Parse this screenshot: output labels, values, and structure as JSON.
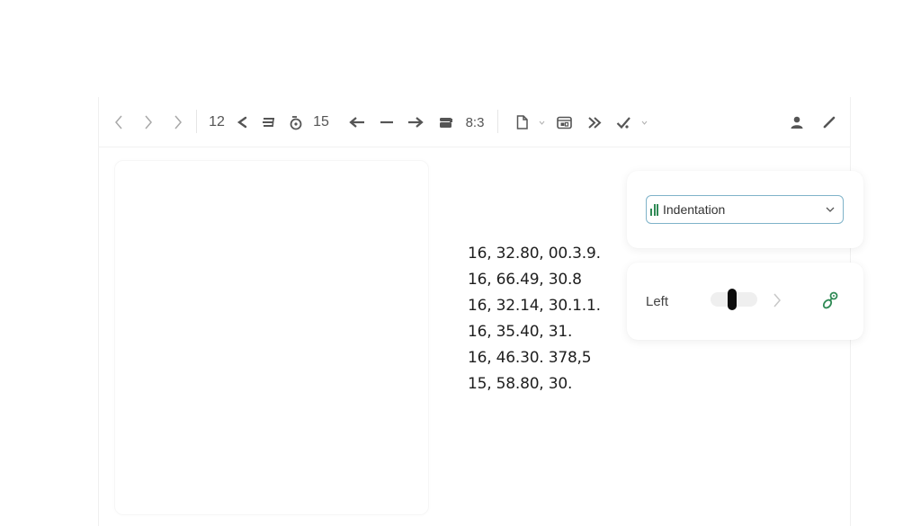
{
  "toolbar": {
    "items": [
      {
        "name": "back-icon",
        "glyph": "chevron-left"
      },
      {
        "name": "forward-icon",
        "glyph": "chevron-right"
      },
      {
        "name": "next-icon",
        "glyph": "chevron-right"
      },
      {
        "name": "font-size-value",
        "text": "12"
      },
      {
        "name": "decrease-indent-icon",
        "glyph": "angle-left-bold"
      },
      {
        "name": "list-style-icon",
        "glyph": "stacked-lines"
      },
      {
        "name": "timer-icon",
        "glyph": "stopwatch"
      },
      {
        "name": "spacing-value",
        "text": "15"
      },
      {
        "name": "arrow-left-icon",
        "glyph": "arrow-left"
      },
      {
        "name": "minus-icon",
        "glyph": "minus"
      },
      {
        "name": "arrow-right-icon",
        "glyph": "arrow-right"
      },
      {
        "name": "stack-icon",
        "glyph": "stack"
      },
      {
        "name": "ratio-value",
        "text": "8:3"
      },
      {
        "name": "document-icon",
        "glyph": "document"
      },
      {
        "name": "document-dropdown-caret",
        "glyph": "caret-down"
      },
      {
        "name": "frame-icon",
        "glyph": "frame"
      },
      {
        "name": "fast-forward-icon",
        "glyph": "double-arrow"
      },
      {
        "name": "tool-icon",
        "glyph": "tool"
      },
      {
        "name": "tool-dropdown-caret",
        "glyph": "caret-down"
      },
      {
        "name": "user-icon",
        "glyph": "person"
      },
      {
        "name": "pen-icon",
        "glyph": "pen"
      }
    ],
    "font_size": "12",
    "spacing": "15",
    "ratio": "8:3"
  },
  "content": {
    "lines": [
      "16, 32.80, 00.3.9.",
      "16, 66.49, 30.8",
      "16, 32.14, 30.1.1.",
      "16, 35.40, 31.",
      "16, 46.30. 378,5",
      "15, 58.80, 30."
    ]
  },
  "indentation_panel": {
    "select_value": "Indentation",
    "select_icon": "bar-chart-icon"
  },
  "alignment_panel": {
    "label": "Left",
    "slider_value_fraction": 0.45,
    "link_icon": "link-icon"
  },
  "colors": {
    "accent_green": "#2f8a55",
    "select_border": "#7fb3c9",
    "icon_gray": "#707070"
  }
}
